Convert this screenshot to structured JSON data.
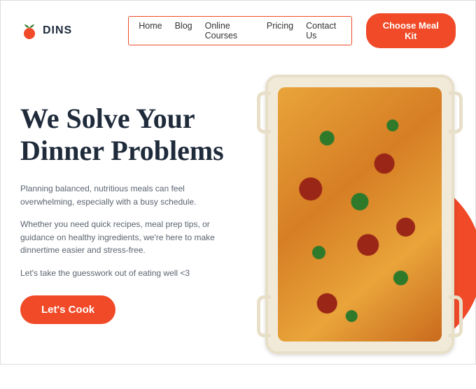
{
  "brand": "DINS",
  "nav": [
    "Home",
    "Blog",
    "Online Courses",
    "Pricing",
    "Contact Us"
  ],
  "cta_top": "Choose Meal Kit",
  "hero": {
    "heading": "We Solve Your Dinner Problems",
    "p1": "Planning balanced, nutritious meals can feel overwhelming, especially with a busy schedule.",
    "p2": "Whether you need quick recipes, meal prep tips, or guidance on healthy ingredients, we're here to make dinnertime easier and stress-free.",
    "p3": "Let's take the guesswork out of eating well <3",
    "cta": "Let's Cook"
  },
  "colors": {
    "accent": "#f04a28",
    "text": "#1e2a3a"
  }
}
